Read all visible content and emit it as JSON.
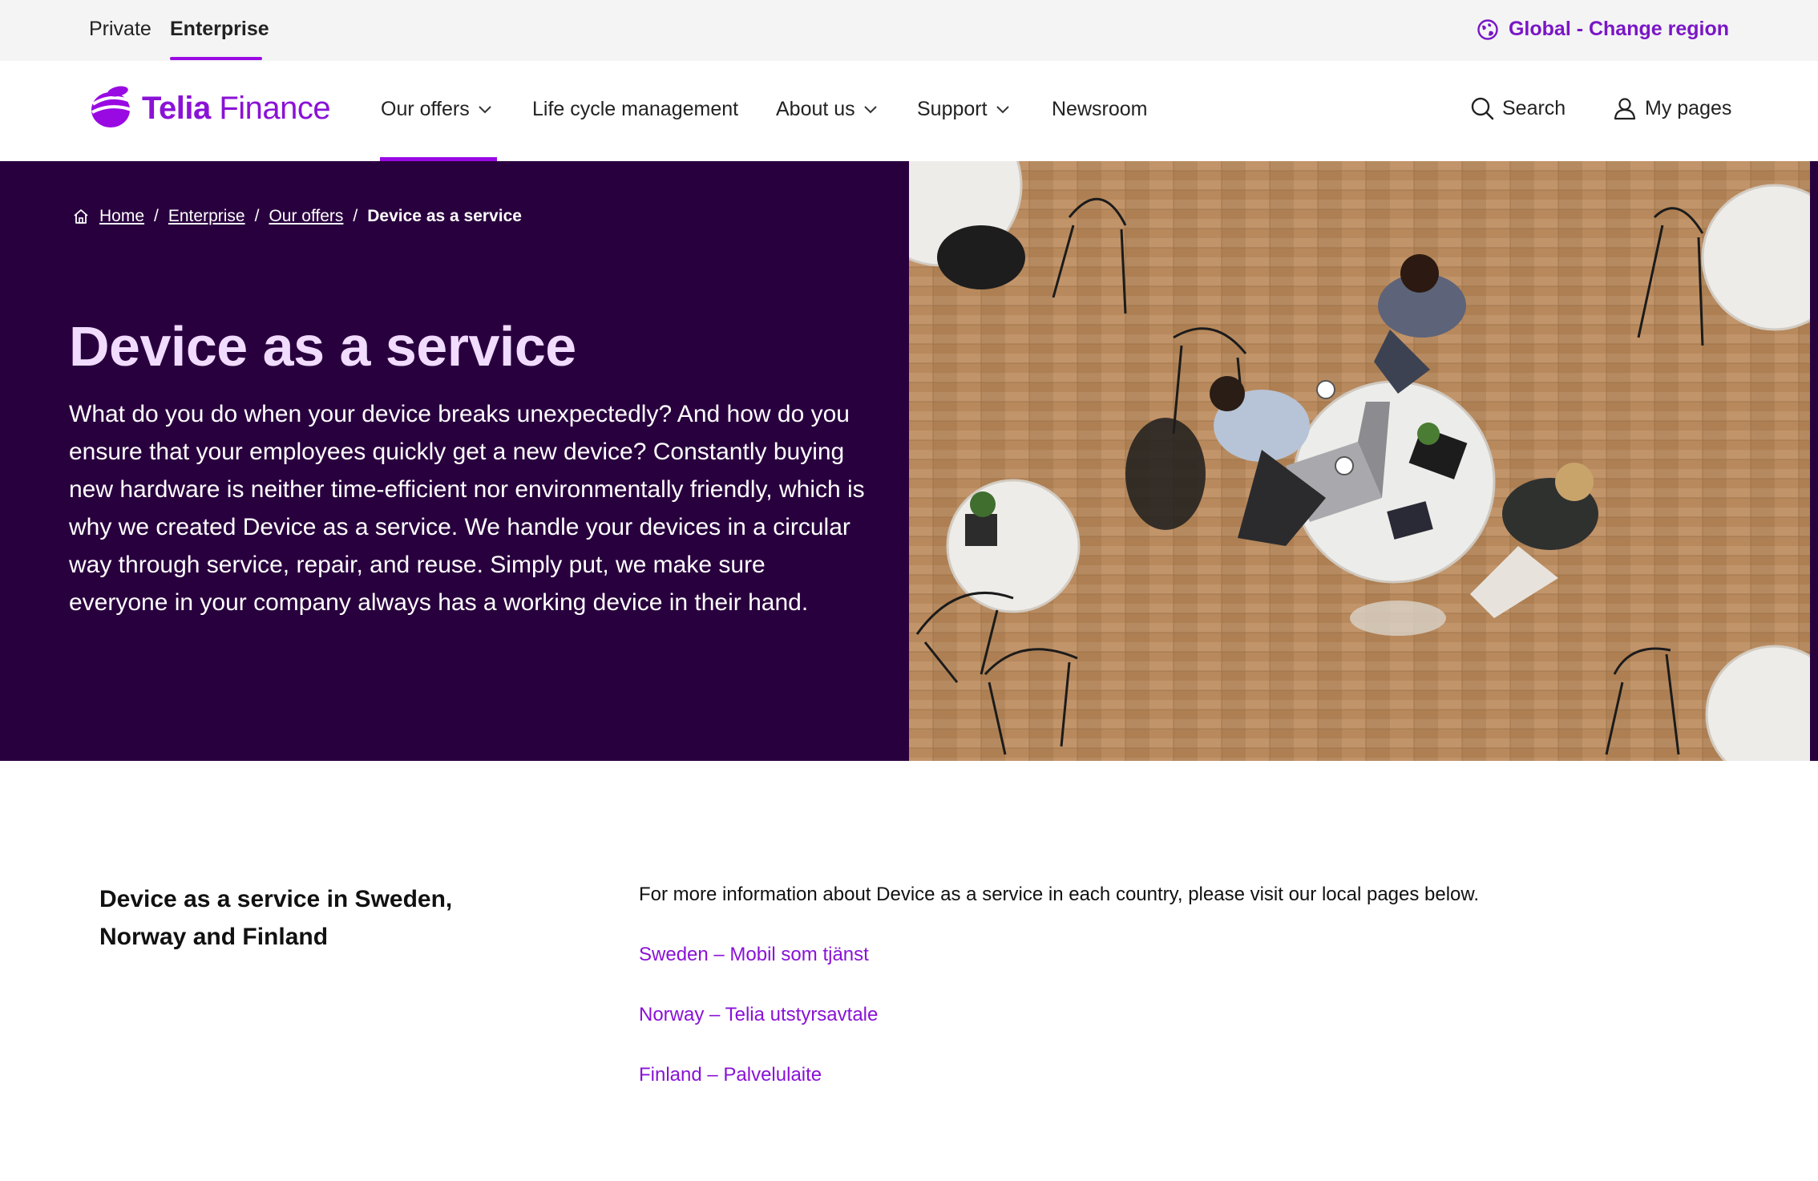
{
  "topbar": {
    "segments": [
      "Private",
      "Enterprise"
    ],
    "active_segment": "Enterprise",
    "region_label": "Global - Change region",
    "region_icon": "globe-icon"
  },
  "brand": {
    "logo_word1": "Telia",
    "logo_word2": "Finance",
    "accent_color": "#990ae3",
    "dark_purple": "#29003e"
  },
  "nav": {
    "items": [
      {
        "label": "Our offers",
        "has_dropdown": true,
        "active": true
      },
      {
        "label": "Life cycle management",
        "has_dropdown": false
      },
      {
        "label": "About us",
        "has_dropdown": true
      },
      {
        "label": "Support",
        "has_dropdown": true
      },
      {
        "label": "Newsroom",
        "has_dropdown": false
      }
    ],
    "search_label": "Search",
    "mypages_label": "My pages"
  },
  "breadcrumb": {
    "items": [
      "Home",
      "Enterprise",
      "Our offers"
    ],
    "current": "Device as a service"
  },
  "hero": {
    "title": "Device as a service",
    "text": "What do you do when your device breaks unexpectedly? And how do you ensure that your employees quickly get a new device? Constantly buying new hardware is neither time-efficient nor environmentally friendly, which is why we created Device as a service. We handle your devices in a circular way through service, repair, and reuse. Simply put, we make sure everyone in your company always has a working device in their hand."
  },
  "info": {
    "heading": "Device as a service in Sweden, Norway and Finland",
    "intro": "For more information about Device as a service in each country, please visit our local pages below.",
    "links": [
      "Sweden – Mobil som tjänst",
      "Norway – Telia utstyrsavtale",
      "Finland – Palvelulaite"
    ]
  }
}
